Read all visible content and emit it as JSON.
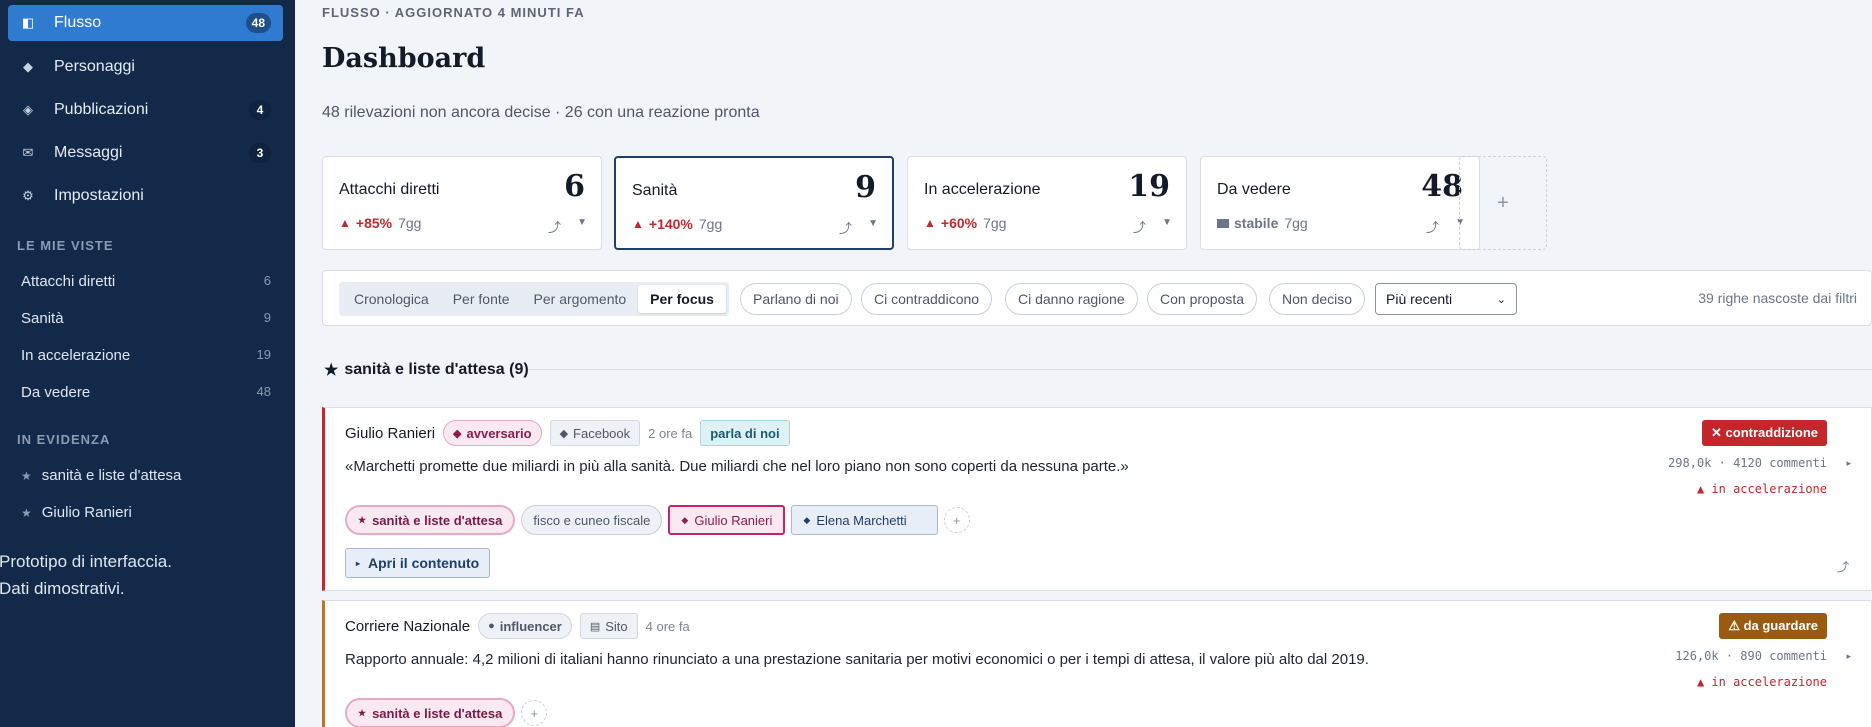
{
  "sidebar": {
    "nav": [
      {
        "label": "Flusso",
        "icon": "sidebar-panel-icon",
        "glyph": "◧",
        "badge": "48",
        "active": true
      },
      {
        "label": "Personaggi",
        "icon": "diamond-icon",
        "glyph": "◆",
        "badge": ""
      },
      {
        "label": "Pubblicazioni",
        "icon": "layers-icon",
        "glyph": "◈",
        "badge": "4"
      },
      {
        "label": "Messaggi",
        "icon": "mail-icon",
        "glyph": "✉",
        "badge": "3"
      },
      {
        "label": "Impostazioni",
        "icon": "gear-icon",
        "glyph": "⚙",
        "badge": ""
      }
    ],
    "views_title": "LE MIE VISTE",
    "views": [
      {
        "label": "Attacchi diretti",
        "count": "6"
      },
      {
        "label": "Sanità",
        "count": "9"
      },
      {
        "label": "In accelerazione",
        "count": "19"
      },
      {
        "label": "Da vedere",
        "count": "48"
      }
    ],
    "highlights_title": "IN EVIDENZA",
    "highlights": [
      {
        "label": "sanità e liste d'attesa"
      },
      {
        "label": "Giulio Ranieri"
      }
    ],
    "prototype_line1": "Prototipo di interfaccia.",
    "prototype_line2": "Dati dimostrativi."
  },
  "header": {
    "crumb": "FLUSSO · AGGIORNATO 4 MINUTI FA",
    "title": "Dashboard",
    "subtitle": "48 rilevazioni non ancora decise · 26 con una reazione pronta"
  },
  "stats": [
    {
      "label": "Attacchi diretti",
      "value": "6",
      "delta": "+85%",
      "period": "7gg",
      "trend": "up"
    },
    {
      "label": "Sanità",
      "value": "9",
      "delta": "+140%",
      "period": "7gg",
      "trend": "up",
      "selected": true
    },
    {
      "label": "In accelerazione",
      "value": "19",
      "delta": "+60%",
      "period": "7gg",
      "trend": "up"
    },
    {
      "label": "Da vedere",
      "value": "48",
      "delta": "stabile",
      "period": "7gg",
      "trend": "flat"
    }
  ],
  "filters": {
    "modes": [
      "Cronologica",
      "Per fonte",
      "Per argomento",
      "Per focus"
    ],
    "active_mode": "Per focus",
    "pills": [
      "Parlano di noi",
      "Ci contraddicono",
      "Ci danno ragione",
      "Con proposta",
      "Non deciso"
    ],
    "sort": "Più recenti",
    "hidden_note": "39 righe nascoste dai filtri"
  },
  "section": {
    "title": "sanità e liste d'attesa (9)"
  },
  "cards": [
    {
      "author": "Giulio Ranieri",
      "role": "avversario",
      "platform": "Facebook",
      "ago": "2 ore fa",
      "mention": "parla di noi",
      "quote": "«Marchetti promette due miliardi in più alla sanità. Due miliardi che nel loro piano non sono coperti da nessuna parte.»",
      "verdict": "✕ contraddizione",
      "metrics": "298,0k · 4120 commenti",
      "accel": "▲ in accelerazione",
      "chips": [
        "sanità e liste d'attesa",
        "fisco e cuneo fiscale",
        "Giulio Ranieri",
        "Elena Marchetti"
      ],
      "open_label": "Apri il contenuto"
    },
    {
      "author": "Corriere Nazionale",
      "role": "influencer",
      "platform": "Sito",
      "ago": "4 ore fa",
      "quote": "Rapporto annuale: 4,2 milioni di italiani hanno rinunciato a una prestazione sanitaria per motivi economici o per i tempi di attesa, il valore più alto dal 2019.",
      "verdict": "⚠ da guardare",
      "metrics": "126,0k · 890 commenti",
      "accel": "▲ in accelerazione",
      "chips": [
        "sanità e liste d'attesa"
      ]
    }
  ],
  "colors": {
    "sidebar": "#12294a",
    "accent": "#2f7bd0",
    "danger": "#c4262c",
    "warning": "#9a5b10"
  }
}
